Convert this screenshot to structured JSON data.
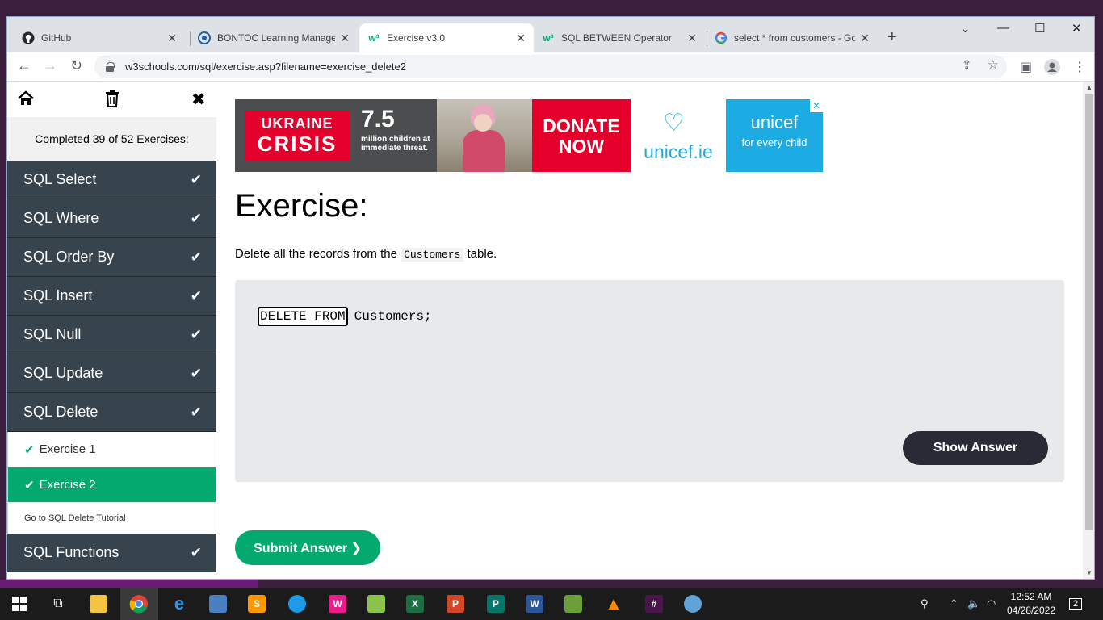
{
  "browser": {
    "tabs": [
      {
        "title": "GitHub",
        "favicon": "github-icon"
      },
      {
        "title": "BONTOC Learning Managem",
        "favicon": "lms-icon"
      },
      {
        "title": "Exercise v3.0",
        "favicon": "w3schools-icon"
      },
      {
        "title": "SQL BETWEEN Operator",
        "favicon": "w3schools-icon"
      },
      {
        "title": "select * from customers - Go",
        "favicon": "google-icon"
      }
    ],
    "active_tab": 2,
    "url": "w3schools.com/sql/exercise.asp?filename=exercise_delete2"
  },
  "sidebar": {
    "completed": "Completed 39 of 52 Exercises:",
    "items": [
      {
        "label": "SQL Select"
      },
      {
        "label": "SQL Where"
      },
      {
        "label": "SQL Order By"
      },
      {
        "label": "SQL Insert"
      },
      {
        "label": "SQL Null"
      },
      {
        "label": "SQL Update"
      },
      {
        "label": "SQL Delete"
      }
    ],
    "subitems": [
      {
        "label": "Exercise 1"
      },
      {
        "label": "Exercise 2"
      }
    ],
    "tutorial_link": "Go to SQL Delete Tutorial",
    "after": {
      "label": "SQL Functions"
    }
  },
  "ad": {
    "headline_1": "UKRAINE",
    "headline_2": "CRISIS",
    "number": "7.5",
    "subtext": "million children at immediate threat.",
    "donate": "DONATE NOW",
    "unicef_ie": "unicef.ie",
    "unicef": "unicef",
    "tagline": "for every child"
  },
  "exercise": {
    "title": "Exercise:",
    "desc_before": "Delete all the records from the",
    "desc_code": "Customers",
    "desc_after": "table.",
    "answer_value": "DELETE FROM",
    "code_rest": "Customers;",
    "show_answer": "Show Answer",
    "submit": "Submit Answer ❯"
  },
  "taskbar": {
    "time": "12:52 AM",
    "date": "04/28/2022",
    "notifications": "2"
  }
}
